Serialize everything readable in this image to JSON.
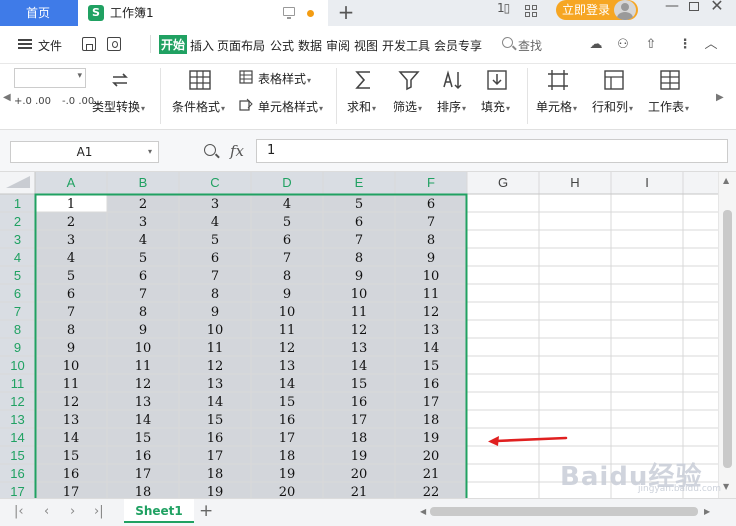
{
  "titlebar": {
    "home_tab": "首页",
    "doc_tab": "工作簿1",
    "login_button": "立即登录"
  },
  "menubar": {
    "file": "文件",
    "items": [
      "开始",
      "插入",
      "页面布局",
      "公式",
      "数据",
      "审阅",
      "视图",
      "开发工具",
      "会员专享"
    ],
    "search": "查找"
  },
  "ribbon": {
    "decimal_increase": "+.0 .00",
    "decimal_decrease": "-.0 .00",
    "type_convert": "类型转换",
    "conditional_format": "条件格式",
    "table_style": "表格样式",
    "cell_style": "单元格样式",
    "sum": "求和",
    "filter": "筛选",
    "sort": "排序",
    "fill": "填充",
    "cell": "单元格",
    "row_col": "行和列",
    "worksheet": "工作表"
  },
  "formulabar": {
    "name_box": "A1",
    "fx": "fx",
    "formula_value": "1"
  },
  "grid": {
    "columns": [
      "A",
      "B",
      "C",
      "D",
      "E",
      "F",
      "G",
      "H",
      "I"
    ],
    "rows": [
      [
        1,
        2,
        3,
        4,
        5,
        6
      ],
      [
        2,
        3,
        4,
        5,
        6,
        7
      ],
      [
        3,
        4,
        5,
        6,
        7,
        8
      ],
      [
        4,
        5,
        6,
        7,
        8,
        9
      ],
      [
        5,
        6,
        7,
        8,
        9,
        10
      ],
      [
        6,
        7,
        8,
        9,
        10,
        11
      ],
      [
        7,
        8,
        9,
        10,
        11,
        12
      ],
      [
        8,
        9,
        10,
        11,
        12,
        13
      ],
      [
        9,
        10,
        11,
        12,
        13,
        14
      ],
      [
        10,
        11,
        12,
        13,
        14,
        15
      ],
      [
        11,
        12,
        13,
        14,
        15,
        16
      ],
      [
        12,
        13,
        14,
        15,
        16,
        17
      ],
      [
        13,
        14,
        15,
        16,
        17,
        18
      ],
      [
        14,
        15,
        16,
        17,
        18,
        19
      ],
      [
        15,
        16,
        17,
        18,
        19,
        20
      ],
      [
        16,
        17,
        18,
        19,
        20,
        21
      ],
      [
        17,
        18,
        19,
        20,
        21,
        22
      ]
    ],
    "selected_columns": 6,
    "active_cell": "A1"
  },
  "tabs": {
    "sheet_name": "Sheet1"
  },
  "colors": {
    "accent_green": "#20a162",
    "selection_fill": "#d3d6db",
    "header_selected": "#d9dde3",
    "arrow_red": "#e02020"
  },
  "watermark": {
    "text": "Baidu经验",
    "sub": "jingyan.baidu.com"
  }
}
